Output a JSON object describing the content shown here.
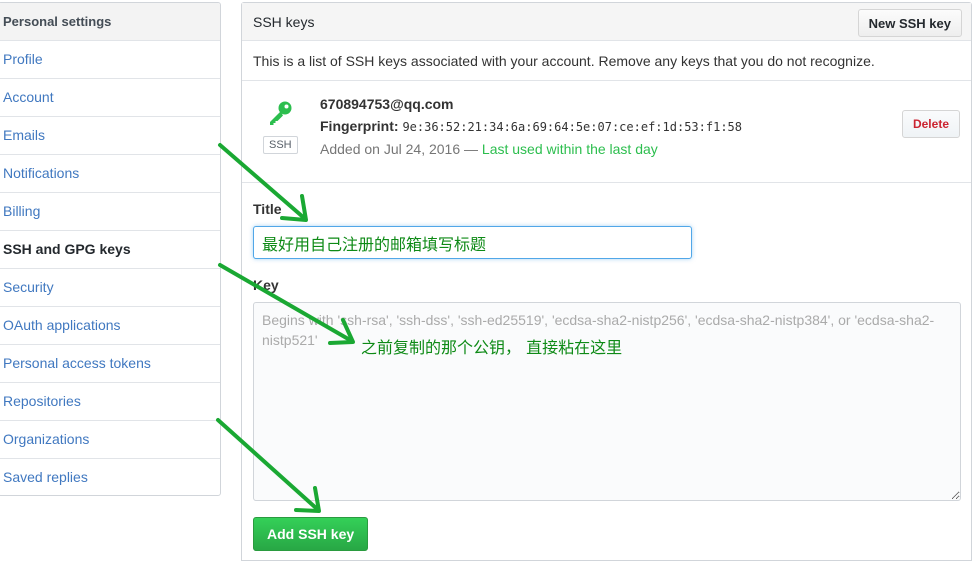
{
  "sidebar": {
    "header": "Personal settings",
    "items": [
      {
        "label": "Profile"
      },
      {
        "label": "Account"
      },
      {
        "label": "Emails"
      },
      {
        "label": "Notifications"
      },
      {
        "label": "Billing"
      },
      {
        "label": "SSH and GPG keys",
        "selected": true
      },
      {
        "label": "Security"
      },
      {
        "label": "OAuth applications"
      },
      {
        "label": "Personal access tokens"
      },
      {
        "label": "Repositories"
      },
      {
        "label": "Organizations"
      },
      {
        "label": "Saved replies"
      }
    ]
  },
  "ssh_keys": {
    "title": "SSH keys",
    "new_button": "New SSH key",
    "description": "This is a list of SSH keys associated with your account. Remove any keys that you do not recognize.",
    "key": {
      "badge": "SSH",
      "email": "670894753@qq.com",
      "fingerprint_label": "Fingerprint:",
      "fingerprint": "9e:36:52:21:34:6a:69:64:5e:07:ce:ef:1d:53:f1:58",
      "added": "Added on Jul 24, 2016 —",
      "last_used": "Last used within the last day",
      "delete_button": "Delete"
    }
  },
  "form": {
    "title_label": "Title",
    "title_value": "最好用自己注册的邮箱填写标题",
    "key_label": "Key",
    "key_placeholder": "Begins with 'ssh-rsa', 'ssh-dss', 'ssh-ed25519', 'ecdsa-sha2-nistp256', 'ecdsa-sha2-nistp384', or 'ecdsa-sha2-nistp521'",
    "add_button": "Add SSH key"
  },
  "annotation": {
    "key_note": "之前复制的那个公钥， 直接粘在这里"
  },
  "colors": {
    "link": "#4078c0",
    "accent_green": "#2cbe4e",
    "arrow_green": "#1aa833",
    "danger": "#cb2431"
  },
  "icons": {
    "key": "key-icon"
  }
}
